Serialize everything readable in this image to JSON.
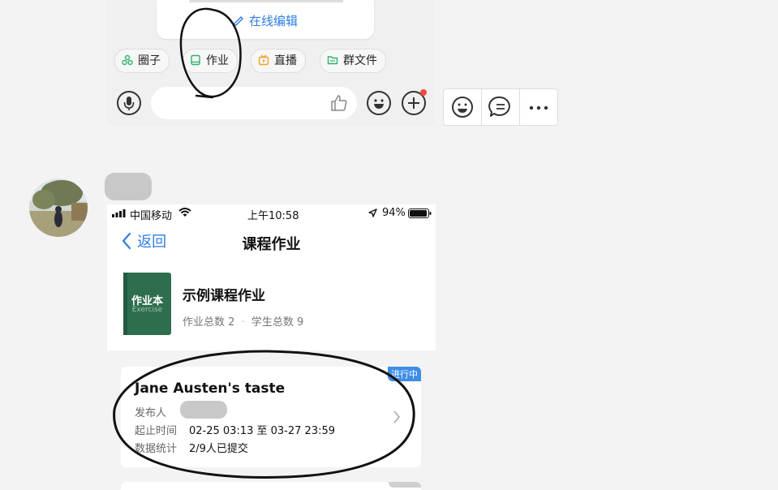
{
  "chat": {
    "doc_card": {
      "edit_label": "在线编辑"
    },
    "chips": [
      {
        "label": "圈子",
        "icon": "circle-group-icon",
        "color": "#2fb36a"
      },
      {
        "label": "作业",
        "icon": "homework-icon",
        "color": "#2fb36a"
      },
      {
        "label": "直播",
        "icon": "live-icon",
        "color": "#f0a020"
      },
      {
        "label": "群文件",
        "icon": "folder-icon",
        "color": "#2fb36a"
      }
    ],
    "toolbar_icons": [
      "emoji-icon",
      "comment-icon",
      "more-icon"
    ]
  },
  "screenshot": {
    "status": {
      "carrier": "中国移动",
      "time": "上午10:58",
      "battery": "94%"
    },
    "nav": {
      "back": "返回",
      "title": "课程作业"
    },
    "course": {
      "cover_title": "作业本",
      "cover_sub": "Exercise",
      "name": "示例课程作业",
      "assignments_label": "作业总数",
      "assignments_count": "2",
      "separator": "·",
      "students_label": "学生总数",
      "students_count": "9"
    },
    "assignment": {
      "badge": "进行中",
      "title": "Jane Austen's taste",
      "publisher_label": "发布人",
      "time_label": "起止时间",
      "time_value": "02-25 03:13 至 03-27 23:59",
      "stats_label": "数据统计",
      "stats_value": "2/9人已提交"
    }
  },
  "colors": {
    "accent": "#2f7de1",
    "badge_blue": "#3f8de6",
    "cover_green": "#2e6e4f"
  }
}
